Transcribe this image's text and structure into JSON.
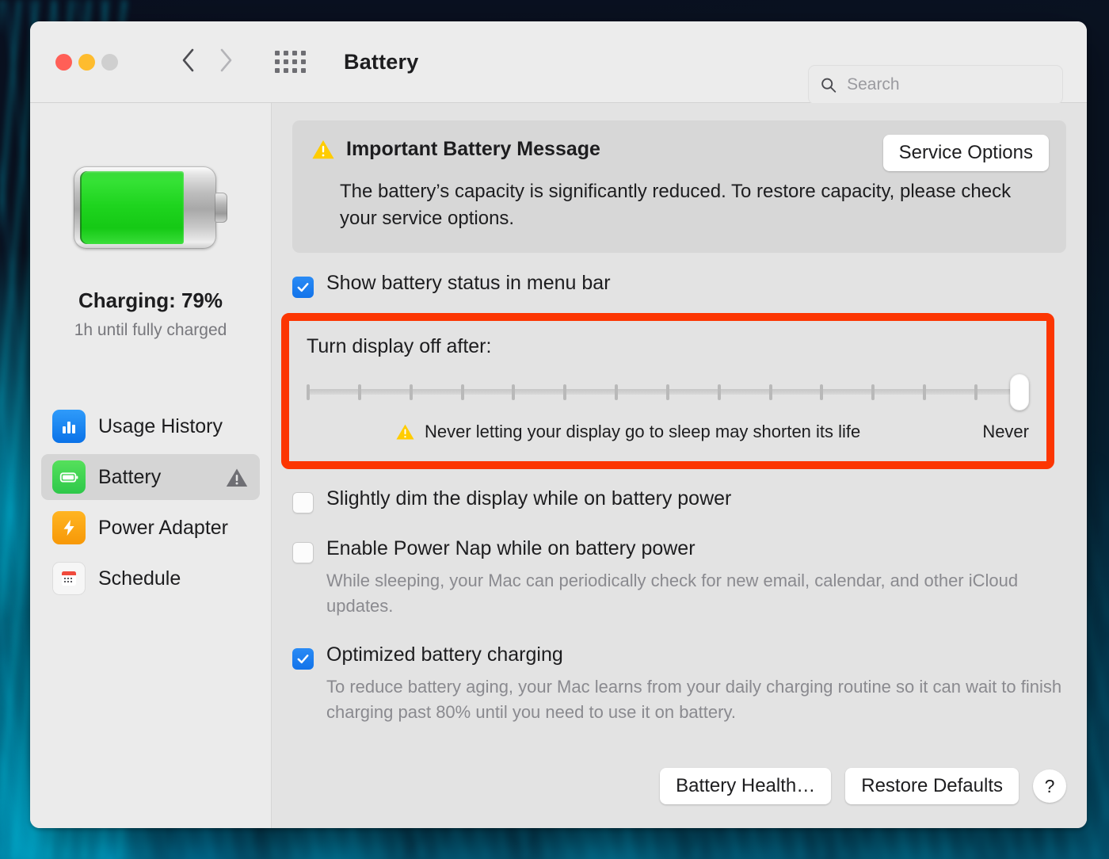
{
  "window": {
    "title": "Battery",
    "traffic_lights": [
      "close",
      "minimize",
      "zoom"
    ],
    "colors": {
      "close": "#ff5f57",
      "minimize": "#febc2e",
      "zoom": "#cfcfcf",
      "accent_blue": "#1273ea",
      "highlight_red": "#fc3602",
      "warning_yellow": "#ffcc00",
      "battery_green": "#22d022"
    }
  },
  "toolbar": {
    "back_icon": "chevron-left-icon",
    "forward_icon": "chevron-right-icon",
    "grid_icon": "grid-apps-icon",
    "title": "Battery",
    "search": {
      "icon": "search-icon",
      "placeholder": "Search",
      "value": ""
    }
  },
  "sidebar": {
    "battery_graphic": {
      "icon": "battery-icon",
      "fill_percent": 79
    },
    "charge_status": "Charging: 79%",
    "charge_subtitle": "1h until fully charged",
    "items": [
      {
        "label": "Usage History",
        "icon": "usage-history-icon",
        "selected": false,
        "badge": null
      },
      {
        "label": "Battery",
        "icon": "battery-sidebar-icon",
        "selected": true,
        "badge": "warning-triangle-icon"
      },
      {
        "label": "Power Adapter",
        "icon": "power-adapter-icon",
        "selected": false,
        "badge": null
      },
      {
        "label": "Schedule",
        "icon": "schedule-calendar-icon",
        "selected": false,
        "badge": null
      }
    ]
  },
  "main": {
    "message_card": {
      "icon": "warning-triangle-icon",
      "title": "Important Battery Message",
      "body": "The battery’s capacity is significantly reduced. To restore capacity, please check your service options.",
      "action_label": "Service Options"
    },
    "show_status": {
      "label": "Show battery status in menu bar",
      "checked": true
    },
    "display_sleep": {
      "title": "Turn display off after:",
      "tick_count": 15,
      "value_label": "Never",
      "thumb_position_percent": 100,
      "warning_icon": "warning-triangle-icon",
      "warning_text": "Never letting your display go to sleep may shorten its life",
      "highlighted": true
    },
    "dim_display": {
      "label": "Slightly dim the display while on battery power",
      "checked": false
    },
    "power_nap": {
      "label": "Enable Power Nap while on battery power",
      "checked": false,
      "description": "While sleeping, your Mac can periodically check for new email, calendar, and other iCloud updates."
    },
    "optimized_charging": {
      "label": "Optimized battery charging",
      "checked": true,
      "description": "To reduce battery aging, your Mac learns from your daily charging routine so it can wait to finish charging past 80% until you need to use it on battery."
    },
    "footer": {
      "battery_health_label": "Battery Health…",
      "restore_defaults_label": "Restore Defaults",
      "help_label": "?"
    }
  }
}
